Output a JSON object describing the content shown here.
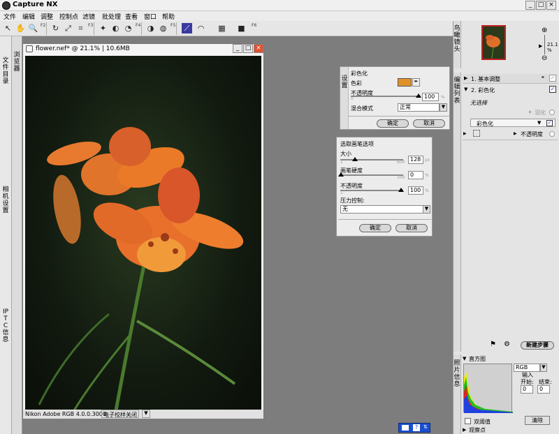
{
  "app": {
    "title": "Capture NX"
  },
  "window_controls": {
    "min": "_",
    "max": "□",
    "close": "×"
  },
  "menu": [
    "文件",
    "编辑",
    "调整",
    "控制点",
    "滤镜",
    "批处理",
    "查看",
    "窗口",
    "帮助"
  ],
  "toolbar": {
    "tools": [
      "↖",
      "✋",
      "🔍",
      "↻",
      "⤢",
      "⌗",
      "✦",
      "◐",
      "◔",
      "◑",
      "◍",
      "●",
      "⟋",
      "◠",
      "▦",
      "■"
    ],
    "group_numbers": [
      "F2",
      "F3",
      "F4",
      "F5",
      "F6"
    ]
  },
  "left_sidebar": {
    "tab1": "文件目录",
    "tab2": "相机设置",
    "tab3": "IPTC信息",
    "tab4": "浏览器"
  },
  "image_window": {
    "title": "flower.nef* @ 21.1% | 10.6MB",
    "profile": "Nikon Adobe RGB 4.0.0.3000",
    "proof": "电子校样关闭"
  },
  "colorize_dialog": {
    "side_label": "设置",
    "title": "彩色化",
    "color_label": "色彩",
    "color_hex": "#e0912a",
    "opacity_label": "不透明度",
    "opacity_min": "0",
    "opacity_value": "100",
    "opacity_unit": "%",
    "blend_label": "混合模式",
    "blend_value": "正常",
    "ok": "确定",
    "cancel": "取消"
  },
  "brush_dialog": {
    "title": "选取画笔选项",
    "size_label": "大小",
    "size_min": "1",
    "size_max": "600",
    "size_value": "128",
    "size_unit": "px",
    "hardness_label": "画笔硬度",
    "hardness_min": "0",
    "hardness_max": "100",
    "hardness_value": "0",
    "hardness_unit": "%",
    "opacity_label": "不透明度",
    "opacity_min": "1",
    "opacity_max": "100",
    "opacity_value": "100",
    "opacity_unit": "%",
    "pressure_label": "压力控制:",
    "pressure_value": "无",
    "ok": "确定",
    "cancel": "取消"
  },
  "right_panel": {
    "birdseye_tab": "鸟瞰镜头",
    "zoom_value": "21.1 %",
    "edit_tab": "编辑列表",
    "step1": "1. 基本调整",
    "step2": "2. 彩色化",
    "no_choice": "无选择",
    "feather": "羽化",
    "colorize_item": "彩色化",
    "opacity": "不透明度",
    "new_step": "新建步骤",
    "info_tab": "照片信息",
    "histogram_title": "直方图",
    "channel": "RGB",
    "input_label": "输入",
    "start_label": "开始:",
    "end_label": "结束:",
    "start_value": "0",
    "end_value": "0",
    "dual_threshold": "双阈值",
    "clear": "清除",
    "watch_points": "观察点"
  }
}
